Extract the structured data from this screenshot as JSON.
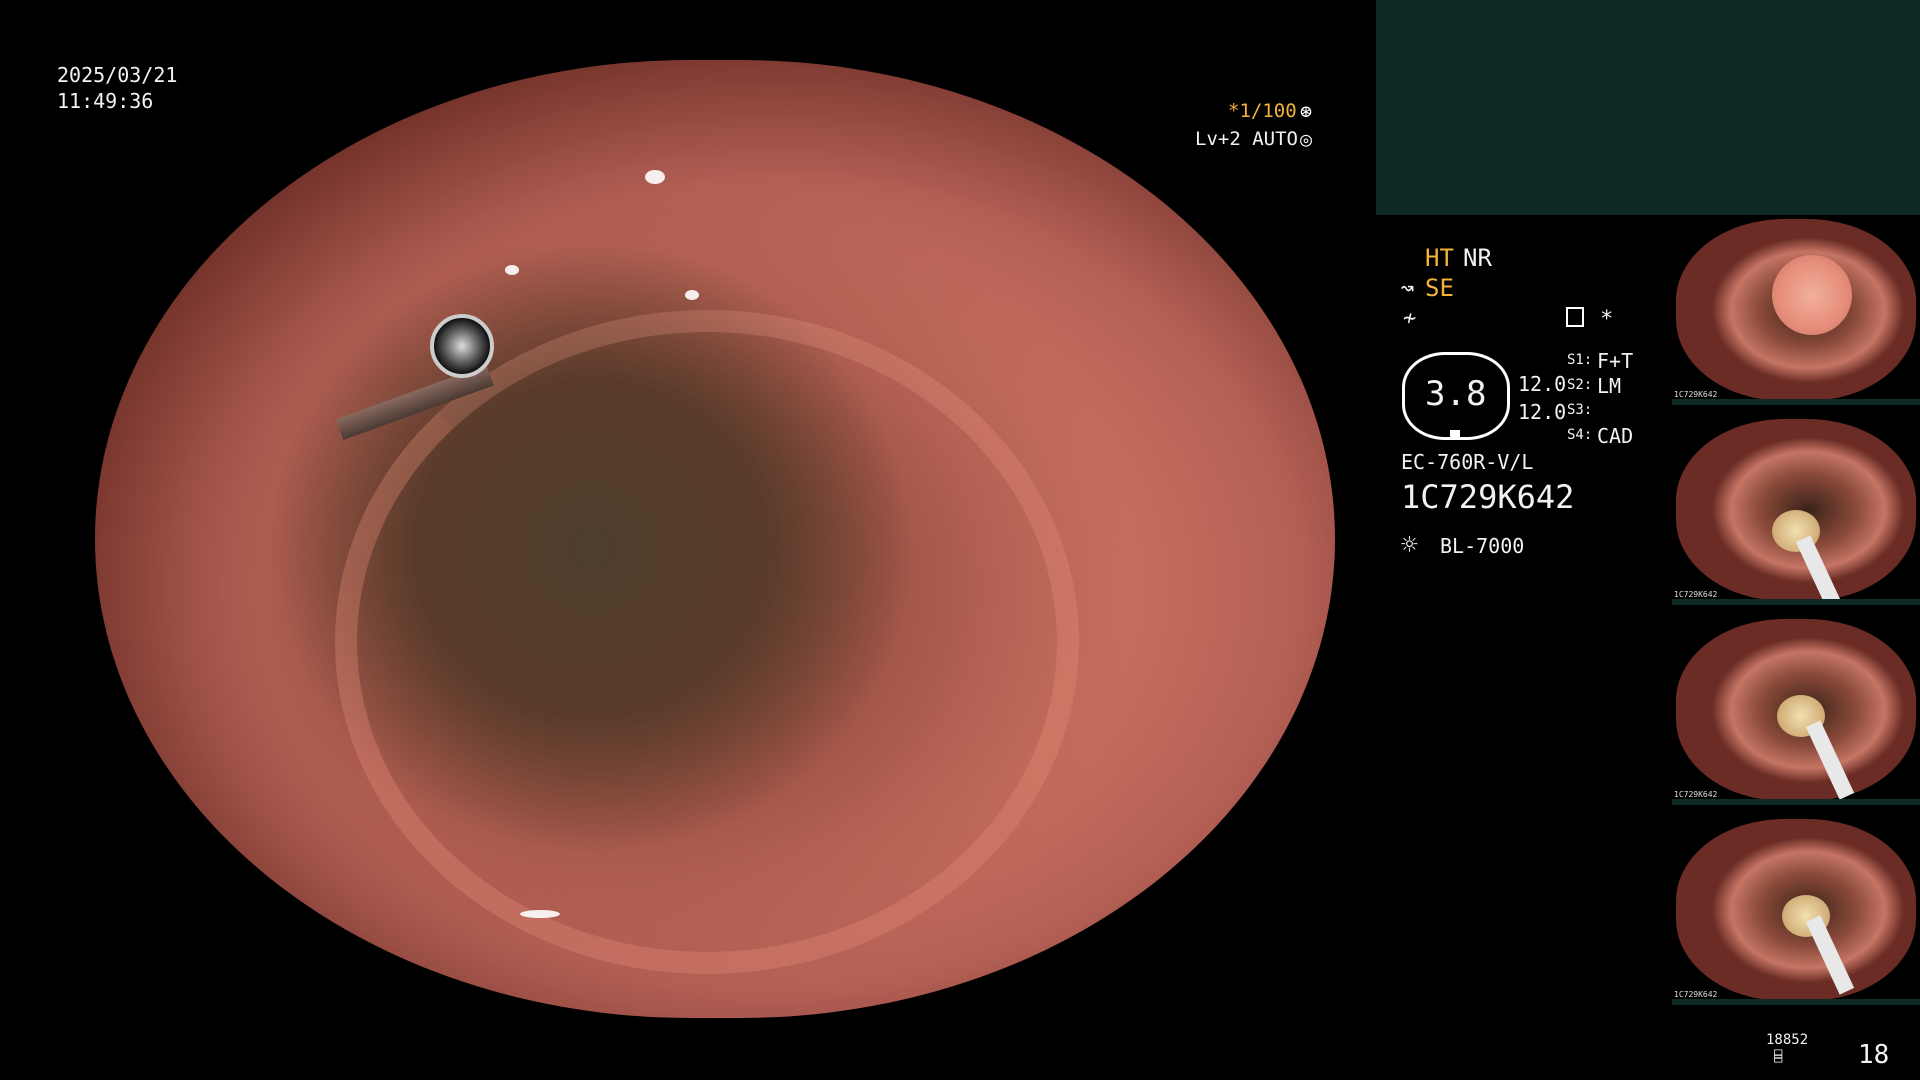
{
  "timestamp": {
    "date": "2025/03/21",
    "time": "11:49:36"
  },
  "overlay": {
    "shutter": "*1/100",
    "shutter_icon": "aperture-icon",
    "level": "Lv+2 AUTO",
    "level_icon": "auto-iris-icon"
  },
  "panel": {
    "ht": "HT",
    "nr": "NR",
    "se": "SE",
    "se_icon_glyph": "↝",
    "ff_icon_glyph": "≁",
    "star": "*",
    "gauge_value": "3.8",
    "v1": "12.0",
    "v2": "12.0",
    "s1_label": "S1:",
    "s2_label": "S2:",
    "s3_label": "S3:",
    "s4_label": "S4:",
    "s1_value": "F+T",
    "s2_value": "LM",
    "s4_value": "CAD",
    "model": "EC-760R-V/L",
    "serial": "1C729K642",
    "light_icon_glyph": "☼",
    "light": "BL-7000"
  },
  "thumbnails": [
    {
      "caption": "1C729K642"
    },
    {
      "caption": "1C729K642"
    },
    {
      "caption": "1C729K642"
    },
    {
      "caption": "1C729K642"
    }
  ],
  "footer": {
    "counter": "18852",
    "counter_icon_glyph": "⌸",
    "page": "18"
  }
}
